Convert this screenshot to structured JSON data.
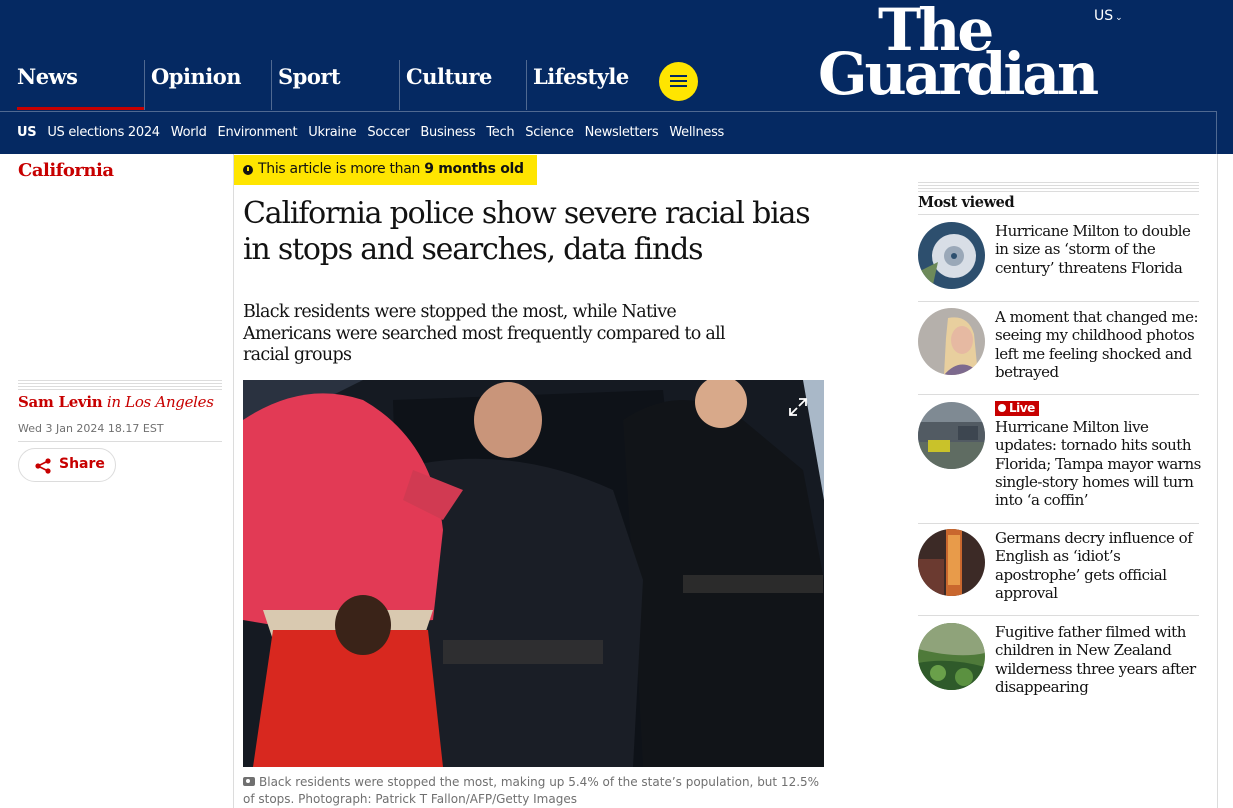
{
  "header": {
    "edition": "US",
    "logo_line1": "The",
    "logo_line2": "Guardian",
    "pillars": [
      "News",
      "Opinion",
      "Sport",
      "Culture",
      "Lifestyle"
    ],
    "subnav": [
      "US",
      "US elections 2024",
      "World",
      "Environment",
      "Ukraine",
      "Soccer",
      "Business",
      "Tech",
      "Science",
      "Newsletters",
      "Wellness"
    ]
  },
  "colors": {
    "brand": "#052962",
    "news_red": "#c70000",
    "highlight_yellow": "#ffe500"
  },
  "article": {
    "section": "California",
    "age_prefix": "This article is more than",
    "age_value": "9 months old",
    "headline": "California police show severe racial bias in stops and searches, data finds",
    "standfirst": "Black residents were stopped the most, while Native Americans were searched most frequently compared to all racial groups",
    "author": "Sam Levin",
    "location": "in Los Angeles",
    "date": "Wed 3 Jan 2024 18.17 EST",
    "share_label": "Share",
    "caption": "Black residents were stopped the most, making up 5.4% of the state’s population, but 12.5% of stops. Photograph: Patrick T Fallon/AFP/Getty Images"
  },
  "most_viewed": {
    "title": "Most viewed",
    "live_label": "Live",
    "items": [
      {
        "headline": "Hurricane Milton to double in size as ‘storm of the century’ threatens Florida",
        "thumb": "hurricane-satellite"
      },
      {
        "headline": "A moment that changed me: seeing my childhood photos left me feeling shocked and betrayed",
        "thumb": "portrait"
      },
      {
        "headline": "Hurricane Milton live updates: tornado hits south Florida; Tampa mayor warns single-story homes will turn into ‘a coffin’",
        "thumb": "storm-street",
        "live": true
      },
      {
        "headline": "Germans decry influence of English as ‘idiot’s apostrophe’ gets official approval",
        "thumb": "shop-sign"
      },
      {
        "headline": "Fugitive father filmed with children in New Zealand wilderness three years after disappearing",
        "thumb": "forest"
      }
    ]
  }
}
